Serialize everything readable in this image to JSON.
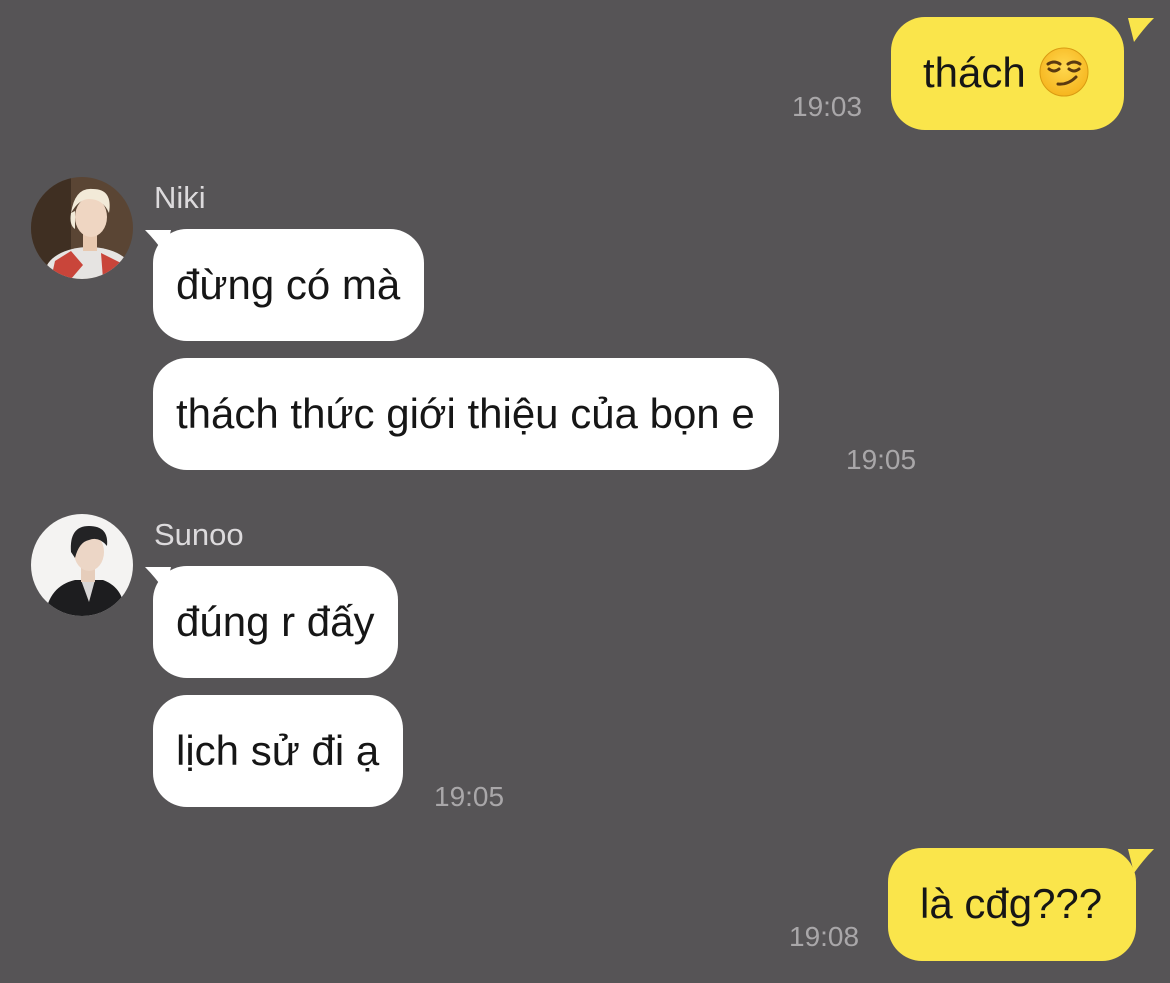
{
  "messages": {
    "m1": {
      "text": "thách",
      "emoji": "smirking-face",
      "time": "19:03"
    },
    "niki": {
      "name": "Niki",
      "m1": {
        "text": "đừng có mà"
      },
      "m2": {
        "text": "thách thức giới thiệu của bọn e",
        "time": "19:05"
      }
    },
    "sunoo": {
      "name": "Sunoo",
      "m1": {
        "text": "đúng r đấy"
      },
      "m2": {
        "text": "lịch sử đi ạ",
        "time": "19:05"
      }
    },
    "m_last": {
      "text": "là cđg???",
      "time": "19:08"
    }
  },
  "colors": {
    "background": "#565456",
    "outgoing_bubble": "#fae54b",
    "incoming_bubble": "#ffffff",
    "timestamp": "#a9a7a9",
    "sender_name": "#dcdadc"
  }
}
